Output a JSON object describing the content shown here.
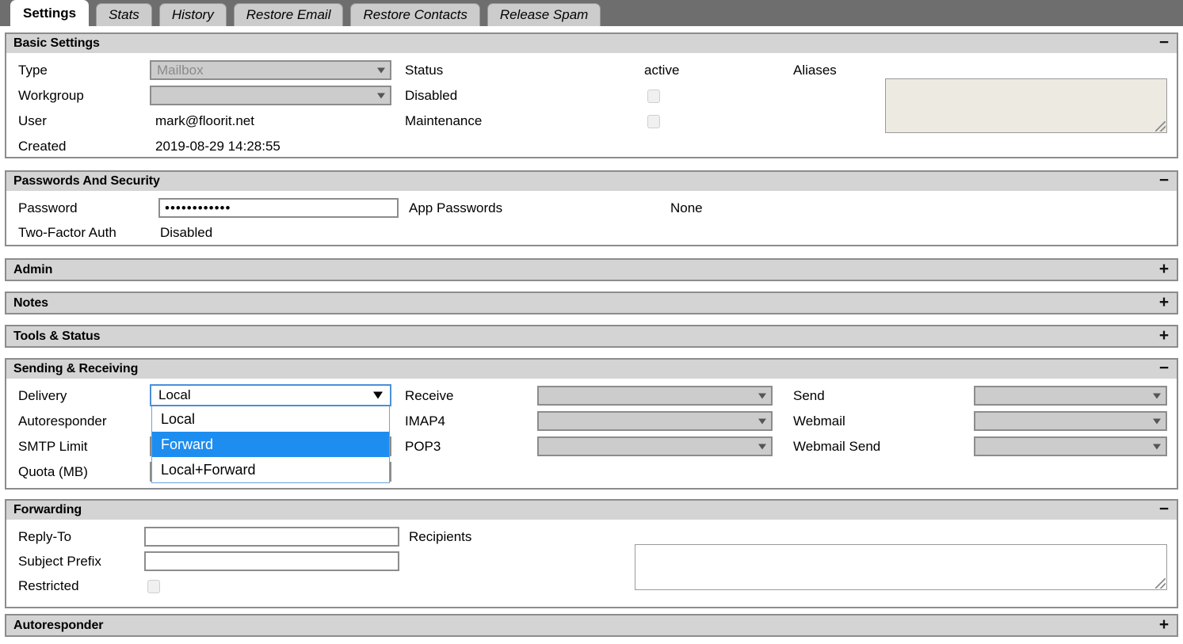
{
  "tabs": [
    {
      "label": "Settings",
      "active": true
    },
    {
      "label": "Stats",
      "active": false
    },
    {
      "label": "History",
      "active": false
    },
    {
      "label": "Restore Email",
      "active": false
    },
    {
      "label": "Restore Contacts",
      "active": false
    },
    {
      "label": "Release Spam",
      "active": false
    }
  ],
  "sections": {
    "basic": {
      "title": "Basic Settings",
      "toggle": "−",
      "labels": {
        "type": "Type",
        "workgroup": "Workgroup",
        "user": "User",
        "created": "Created",
        "status": "Status",
        "disabled": "Disabled",
        "maintenance": "Maintenance",
        "aliases": "Aliases"
      },
      "values": {
        "type": "Mailbox",
        "workgroup": "",
        "user": "mark@floorit.net",
        "created": "2019-08-29 14:28:55",
        "status": "active",
        "aliases": ""
      }
    },
    "passwords": {
      "title": "Passwords And Security",
      "toggle": "−",
      "labels": {
        "password": "Password",
        "two_factor": "Two-Factor Auth",
        "app_passwords": "App Passwords"
      },
      "values": {
        "password": "••••••••••••",
        "two_factor": "Disabled",
        "app_passwords": "None"
      }
    },
    "admin": {
      "title": "Admin",
      "toggle": "+"
    },
    "notes": {
      "title": "Notes",
      "toggle": "+"
    },
    "tools": {
      "title": "Tools & Status",
      "toggle": "+"
    },
    "sending": {
      "title": "Sending & Receiving",
      "toggle": "−",
      "labels": {
        "delivery": "Delivery",
        "autoresponder": "Autoresponder",
        "smtp_limit": "SMTP Limit",
        "quota": "Quota (MB)",
        "receive": "Receive",
        "imap4": "IMAP4",
        "pop3": "POP3",
        "send": "Send",
        "webmail": "Webmail",
        "webmail_send": "Webmail Send"
      },
      "values": {
        "delivery": "Local",
        "receive": "",
        "imap4": "",
        "pop3": "",
        "send": "",
        "webmail": "",
        "webmail_send": ""
      },
      "delivery_dropdown": {
        "open": true,
        "selected": "Local",
        "highlighted": "Forward",
        "options": [
          "Local",
          "Forward",
          "Local+Forward"
        ]
      }
    },
    "forwarding": {
      "title": "Forwarding",
      "toggle": "−",
      "labels": {
        "reply_to": "Reply-To",
        "subject_prefix": "Subject Prefix",
        "restricted": "Restricted",
        "recipients": "Recipients"
      },
      "values": {
        "reply_to": "",
        "subject_prefix": "",
        "recipients": ""
      }
    },
    "autoresponder": {
      "title": "Autoresponder",
      "toggle": "+"
    }
  },
  "colors": {
    "tabbar_bg": "#6e6e6e",
    "header_bg": "#d4d4d4",
    "panel_border": "#8c8c8c",
    "dropdown_highlight": "#1d8df0",
    "dropdown_focus_border": "#4a90d9",
    "disabled_field_bg": "#cccccc",
    "disabled_textarea_bg": "#eceae1"
  }
}
